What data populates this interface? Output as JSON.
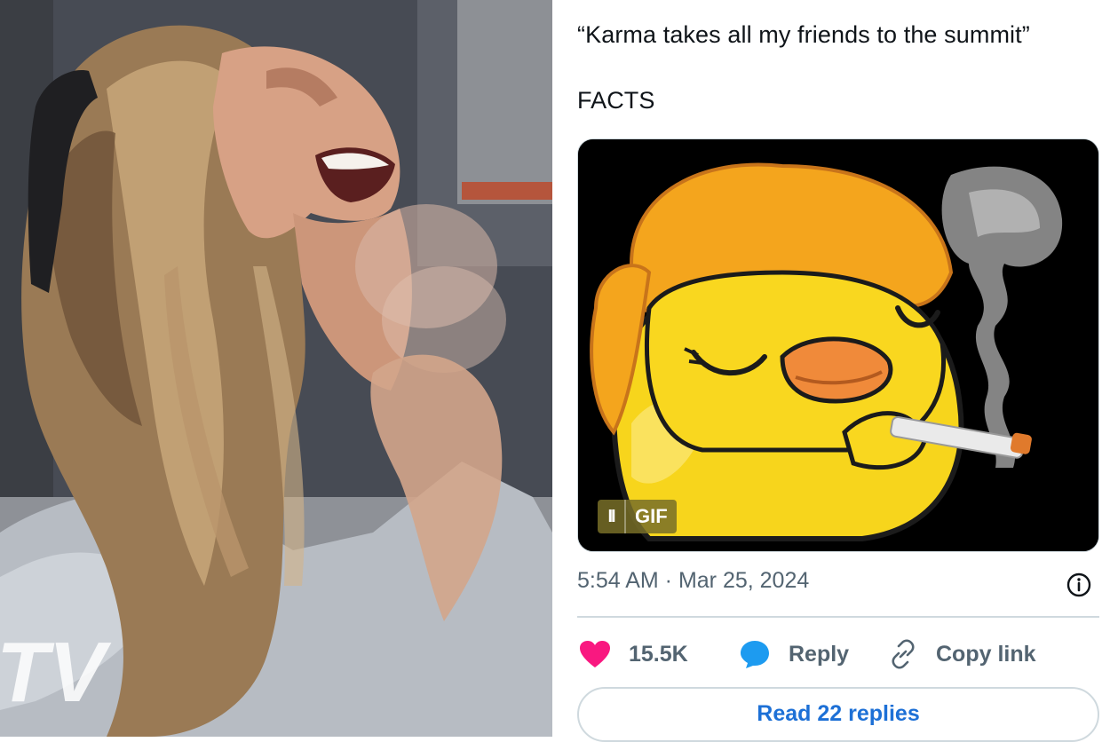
{
  "photo": {
    "watermark": "TV"
  },
  "tweet": {
    "text_line_1": "“Karma takes all my friends to the summit”",
    "text_line_2": "FACTS",
    "media": {
      "pause_glyph": "II",
      "badge_label": "GIF"
    },
    "timestamp": "5:54 AM · Mar 25, 2024",
    "actions": {
      "like_count": "15.5K",
      "reply_label": "Reply",
      "copy_label": "Copy link"
    },
    "read_replies_label": "Read 22 replies"
  },
  "colors": {
    "like_pink": "#f91880",
    "reply_blue": "#1d9bf0",
    "link_blue": "#1d70d6",
    "secondary_text": "#536471",
    "border": "#cfd9de"
  },
  "icons": [
    "heart-icon",
    "reply-bubble-icon",
    "link-icon",
    "info-icon",
    "pause-icon"
  ]
}
